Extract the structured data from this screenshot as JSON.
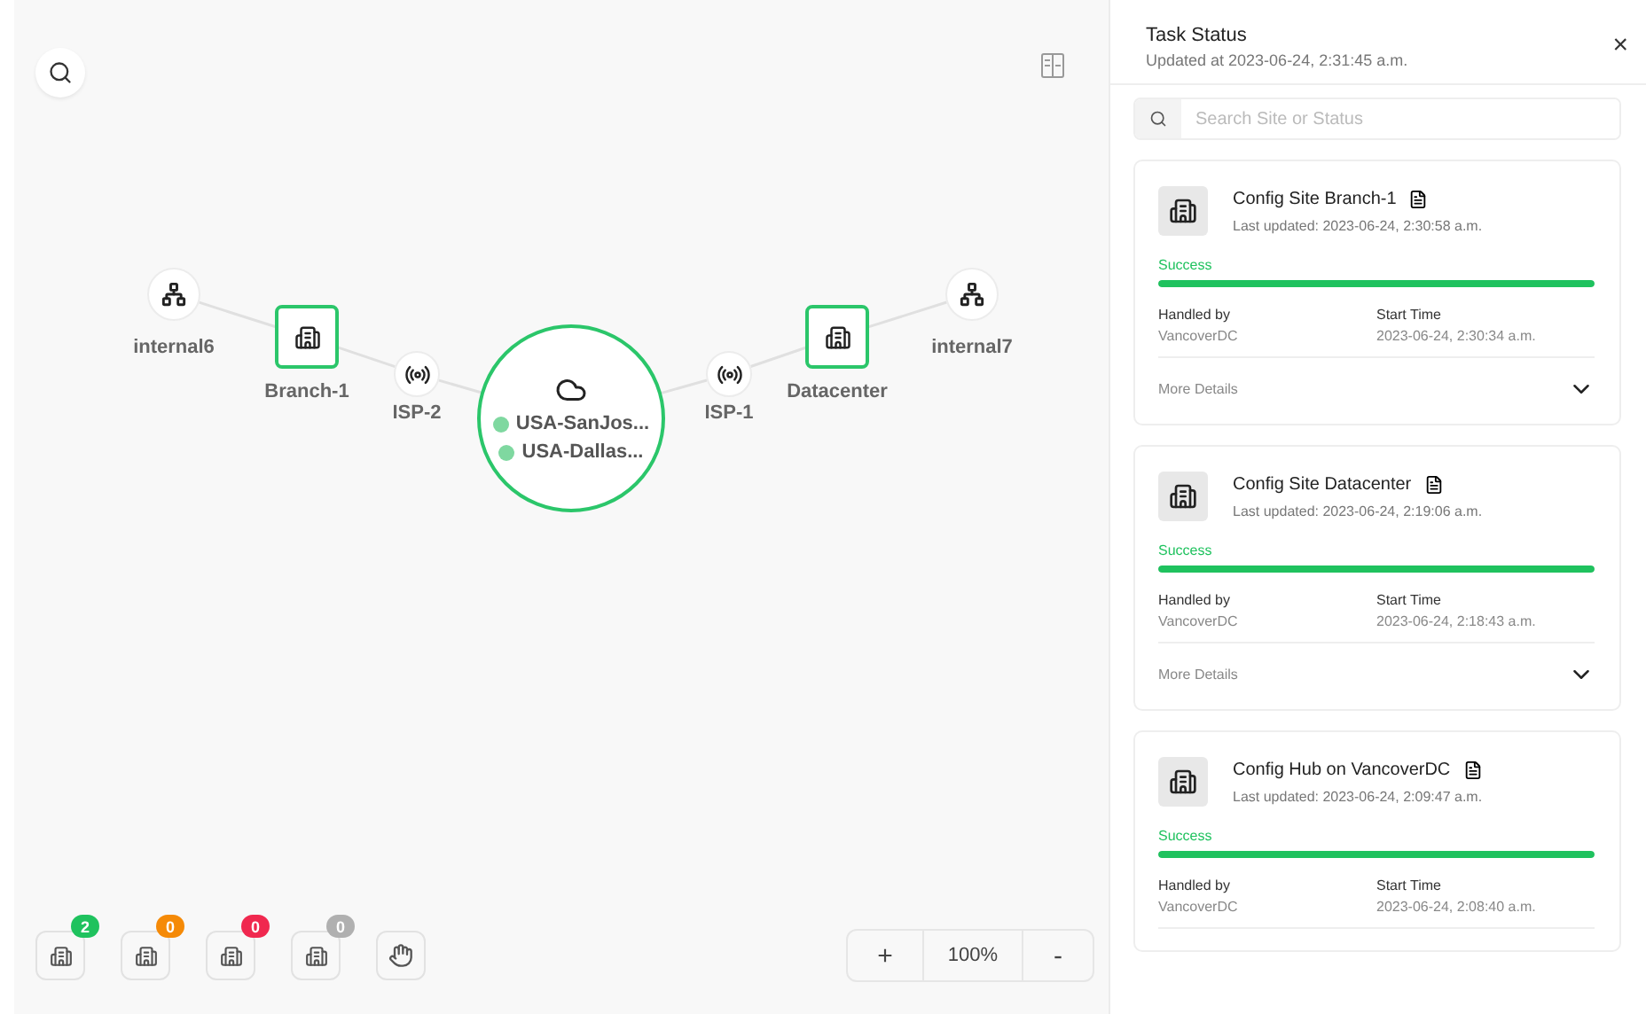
{
  "map": {
    "nodes": [
      {
        "kind": "hub",
        "label": "internal6"
      },
      {
        "kind": "site",
        "label": "Branch-1"
      },
      {
        "kind": "isp",
        "label": "ISP-2"
      },
      {
        "kind": "cloud",
        "regions": [
          {
            "label": "USA-SanJos...",
            "color": "#7fd8a0"
          },
          {
            "label": "USA-Dallas...",
            "color": "#7fd8a0"
          }
        ]
      },
      {
        "kind": "isp",
        "label": "ISP-1"
      },
      {
        "kind": "site",
        "label": "Datacenter"
      },
      {
        "kind": "hub",
        "label": "internal7"
      }
    ]
  },
  "status_filters": [
    {
      "count": "2",
      "color": "#1fc25e"
    },
    {
      "count": "0",
      "color": "#f58a07"
    },
    {
      "count": "0",
      "color": "#f0284f"
    },
    {
      "count": "0",
      "color": "#b0b0b0"
    }
  ],
  "zoom": {
    "plus": "+",
    "level": "100%",
    "minus": "-"
  },
  "panel": {
    "title": "Task Status",
    "subtitle": "Updated at 2023-06-24, 2:31:45 a.m.",
    "close": "×",
    "search": {
      "placeholder": "Search Site or Status"
    },
    "cards": [
      {
        "title": "Config Site Branch-1",
        "updated": "Last updated: 2023-06-24, 2:30:58 a.m.",
        "status": "Success",
        "level": 1,
        "handled_label": "Handled by",
        "handled_value": "VancoverDC",
        "start_label": "Start Time",
        "start_value": "2023-06-24, 2:30:34 a.m.",
        "more": "More Details",
        "expanded": false
      },
      {
        "title": "Config Site Datacenter",
        "updated": "Last updated: 2023-06-24, 2:19:06 a.m.",
        "status": "Success",
        "level": 1,
        "handled_label": "Handled by",
        "handled_value": "VancoverDC",
        "start_label": "Start Time",
        "start_value": "2023-06-24, 2:18:43 a.m.",
        "more": "More Details",
        "expanded": false
      },
      {
        "title": "Config Hub on VancoverDC",
        "updated": "Last updated: 2023-06-24, 2:09:47 a.m.",
        "status": "Success",
        "level": 1,
        "handled_label": "Handled by",
        "handled_value": "VancoverDC",
        "start_label": "Start Time",
        "start_value": "2023-06-24, 2:08:40 a.m."
      }
    ]
  }
}
